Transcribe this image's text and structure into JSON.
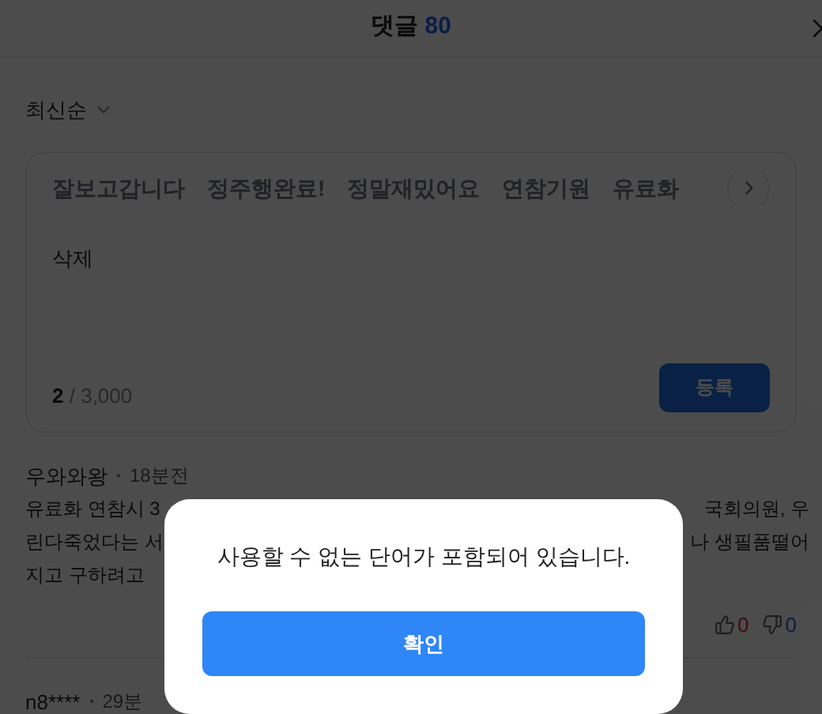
{
  "header": {
    "title": "댓글",
    "count": "80"
  },
  "sort": {
    "label": "최신순"
  },
  "composer": {
    "tags": [
      "잘보고갑니다",
      "정주행완료!",
      "정말재밌어요",
      "연참기원",
      "유료화"
    ],
    "value": "삭제",
    "count": "2",
    "limit": "/ 3,000",
    "submit": "등록"
  },
  "comments": [
    {
      "author": "우와와왕",
      "time": "18분전",
      "lines": [
        {
          "left": "유료화 연참시 3",
          "right": "국회의원, 우"
        },
        {
          "left": "린다죽었다는 서",
          "right": "나 생필품떨어"
        },
        {
          "left": "지고 구하려고"
        }
      ],
      "likes": "0",
      "dislikes": "0"
    },
    {
      "author": "n8****",
      "time": "29분"
    }
  ],
  "dialog": {
    "message": "사용할 수 없는 단어가 포함되어 있습니다.",
    "button": "확인"
  }
}
